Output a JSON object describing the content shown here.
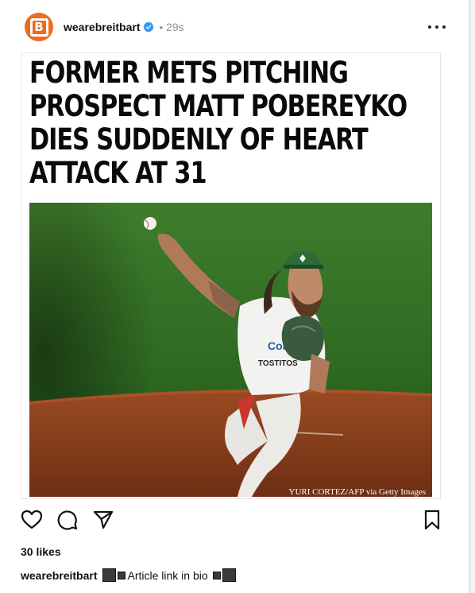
{
  "post": {
    "username": "wearebreitbart",
    "time": "29s",
    "dot": "•",
    "avatar_letter": "B"
  },
  "media": {
    "headline": "FORMER METS PITCHING PROSPECT MATT POBEREYKO DIES SUDDENLY OF HEART ATTACK AT 31",
    "credit": "YURI CORTEZ/AFP via Getty Images"
  },
  "stats": {
    "likes": "30 likes"
  },
  "caption": {
    "username": "wearebreitbart",
    "text": "Article link in bio"
  },
  "colors": {
    "brand": "#f06a1d",
    "verified": "#3797f0"
  },
  "icons": [
    "heart-icon",
    "comment-icon",
    "share-icon",
    "bookmark-icon",
    "verified-icon",
    "more-icon"
  ]
}
